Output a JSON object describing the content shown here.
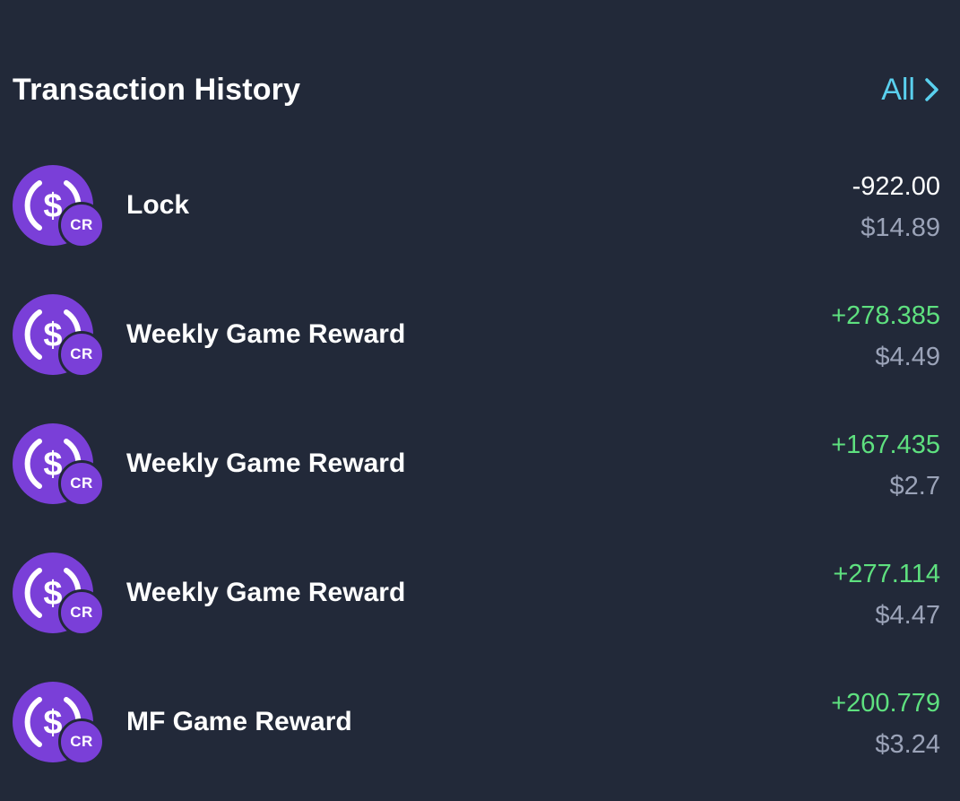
{
  "header": {
    "title": "Transaction History",
    "all_label": "All"
  },
  "colors": {
    "background": "#222939",
    "accent": "#5ad0ee",
    "positive": "#5ee07f",
    "coin": "#7a3fd8",
    "secondary_text": "#9ba3b8"
  },
  "transactions": [
    {
      "label": "Lock",
      "amount": "-922.00",
      "usd": "$14.89",
      "direction": "negative",
      "icon": "usd-coin-icon",
      "badge": "CR"
    },
    {
      "label": "Weekly Game Reward",
      "amount": "+278.385",
      "usd": "$4.49",
      "direction": "positive",
      "icon": "usd-coin-icon",
      "badge": "CR"
    },
    {
      "label": "Weekly Game Reward",
      "amount": "+167.435",
      "usd": "$2.7",
      "direction": "positive",
      "icon": "usd-coin-icon",
      "badge": "CR"
    },
    {
      "label": "Weekly Game Reward",
      "amount": "+277.114",
      "usd": "$4.47",
      "direction": "positive",
      "icon": "usd-coin-icon",
      "badge": "CR"
    },
    {
      "label": "MF Game Reward",
      "amount": "+200.779",
      "usd": "$3.24",
      "direction": "positive",
      "icon": "usd-coin-icon",
      "badge": "CR"
    }
  ]
}
